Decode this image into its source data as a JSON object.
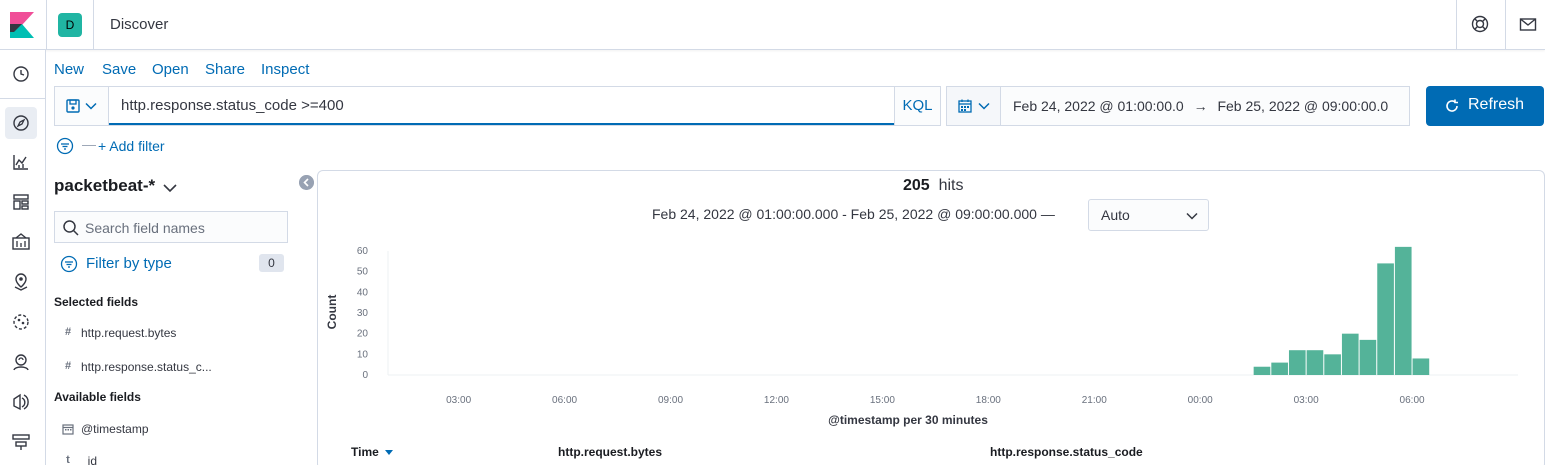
{
  "header": {
    "space_initial": "D",
    "app_title": "Discover",
    "icons": [
      "kibana-logo-icon",
      "help-icon",
      "newsfeed-mail-icon"
    ]
  },
  "nav": {
    "icons": [
      "clock-icon",
      "discover-compass-icon",
      "visualize-icon",
      "dashboard-icon",
      "canvas-icon",
      "maps-icon",
      "ml-icon",
      "graph-icon",
      "apm-icon",
      "uptime-icon"
    ],
    "active": "discover-compass-icon"
  },
  "top_menu": [
    {
      "label": "New"
    },
    {
      "label": "Save"
    },
    {
      "label": "Open"
    },
    {
      "label": "Share"
    },
    {
      "label": "Inspect"
    }
  ],
  "query": {
    "value": "http.response.status_code >=400",
    "language": "KQL"
  },
  "date_range": {
    "start": "Feb 24, 2022 @ 01:00:00.0",
    "arrow": "→",
    "end": "Feb 25, 2022 @ 09:00:00.0"
  },
  "refresh_label": "Refresh",
  "filter_bar": {
    "dash": "—",
    "add_filter": "+ Add filter"
  },
  "sidebar": {
    "index_pattern": "packetbeat-*",
    "search_placeholder": "Search field names",
    "filter_by_type": "Filter by type",
    "filter_count": "0",
    "selected_title": "Selected fields",
    "selected_fields": [
      {
        "type": "#",
        "name": "http.request.bytes"
      },
      {
        "type": "#",
        "name": "http.response.status_c..."
      }
    ],
    "available_title": "Available fields",
    "available_fields": [
      {
        "type": "date",
        "name": "@timestamp"
      },
      {
        "type": "t",
        "name": "_id"
      }
    ]
  },
  "results": {
    "hits_count": "205",
    "hits_label": "hits",
    "range_text": "Feb 24, 2022 @ 01:00:00.000 - Feb 25, 2022 @ 09:00:00.000 —",
    "interval": "Auto"
  },
  "table_headers": {
    "time": "Time",
    "col1": "http.request.bytes",
    "col2": "http.response.status_code"
  },
  "chart_data": {
    "type": "bar",
    "xlabel": "@timestamp per 30 minutes",
    "ylabel": "Count",
    "ylim": [
      0,
      60
    ],
    "y_ticks": [
      "0",
      "10",
      "20",
      "30",
      "40",
      "50",
      "60"
    ],
    "x_ticks": [
      "03:00",
      "06:00",
      "09:00",
      "12:00",
      "15:00",
      "18:00",
      "21:00",
      "00:00",
      "03:00",
      "06:00"
    ],
    "x_tick_hours": [
      2,
      5,
      8,
      11,
      14,
      17,
      20,
      23,
      26,
      29
    ],
    "x_range_hours": [
      0,
      32
    ],
    "bar_color": "#54b399",
    "bars": [
      {
        "start_hour": 24.5,
        "count": 4
      },
      {
        "start_hour": 25.0,
        "count": 6
      },
      {
        "start_hour": 25.5,
        "count": 12
      },
      {
        "start_hour": 26.0,
        "count": 12
      },
      {
        "start_hour": 26.5,
        "count": 10
      },
      {
        "start_hour": 27.0,
        "count": 20
      },
      {
        "start_hour": 27.5,
        "count": 17
      },
      {
        "start_hour": 28.0,
        "count": 54
      },
      {
        "start_hour": 28.5,
        "count": 62
      },
      {
        "start_hour": 29.0,
        "count": 8
      }
    ]
  },
  "colors": {
    "accent": "#006bb4",
    "space_badge": "#20b5a3",
    "bar": "#54b399"
  }
}
